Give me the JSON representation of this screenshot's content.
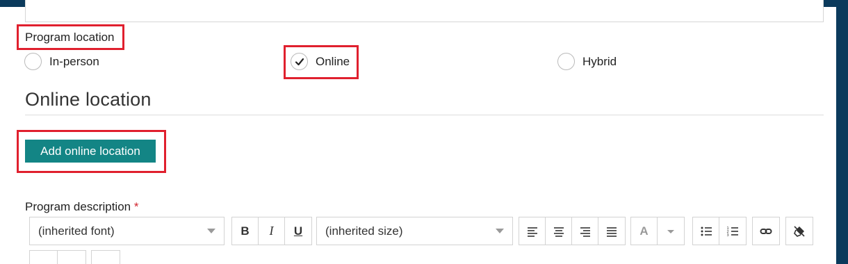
{
  "program_location": {
    "label": "Program location",
    "options": [
      {
        "label": "In-person",
        "checked": false
      },
      {
        "label": "Online",
        "checked": true
      },
      {
        "label": "Hybrid",
        "checked": false
      }
    ]
  },
  "online_location": {
    "title": "Online location",
    "add_button_label": "Add online location"
  },
  "program_description": {
    "label": "Program description",
    "required_mark": "*"
  },
  "editor_toolbar": {
    "font_select": "(inherited font)",
    "size_select": "(inherited size)",
    "bold": "B",
    "italic": "I",
    "underline": "U",
    "font_color": "A"
  },
  "colors": {
    "accent": "#138585",
    "highlight": "#e0202e",
    "frame": "#0b3a5c",
    "required": "#d0242e"
  }
}
